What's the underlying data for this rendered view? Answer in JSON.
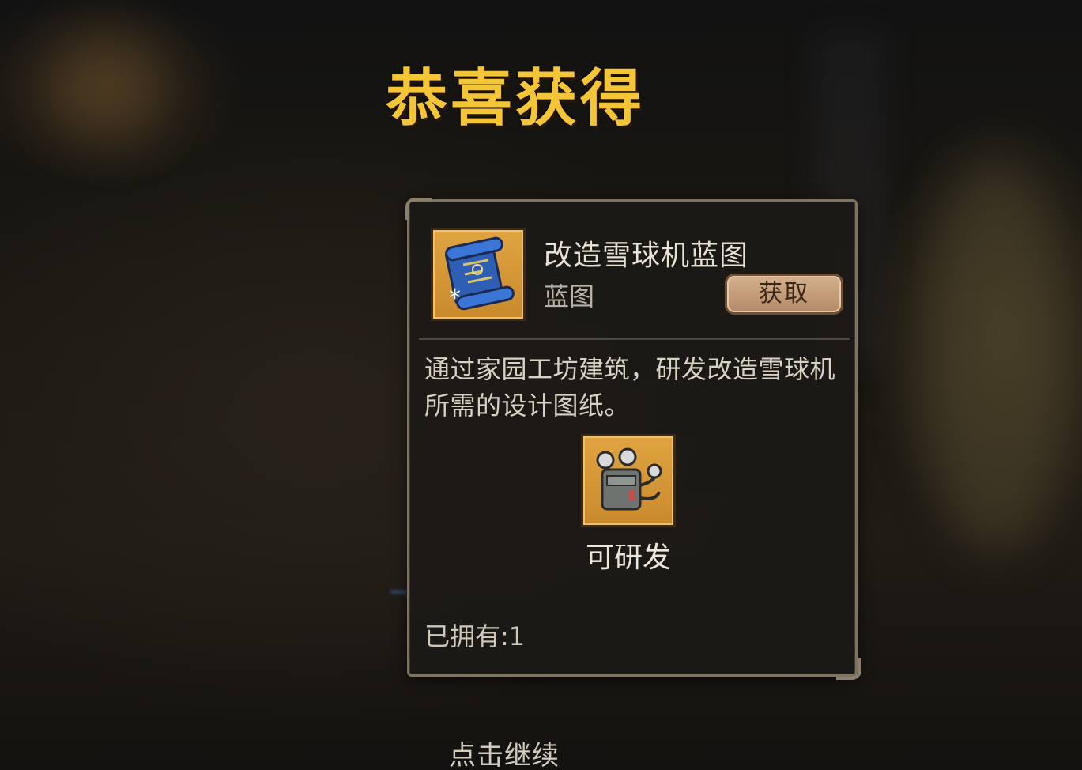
{
  "dialog": {
    "title": "恭喜获得",
    "item": {
      "name": "改造雪球机蓝图",
      "type": "蓝图",
      "icon": "blueprint-scroll-icon",
      "obtain_label": "获取",
      "description": "通过家园工坊建筑，研发改造雪球机所需的设计图纸。",
      "product_icon": "snowball-machine-icon",
      "product_label": "可研发",
      "owned": "已拥有:1"
    },
    "continue_label": "点击继续"
  },
  "colors": {
    "title": "#f4c537",
    "frame": "#d99b38",
    "button": "#c49c78"
  }
}
